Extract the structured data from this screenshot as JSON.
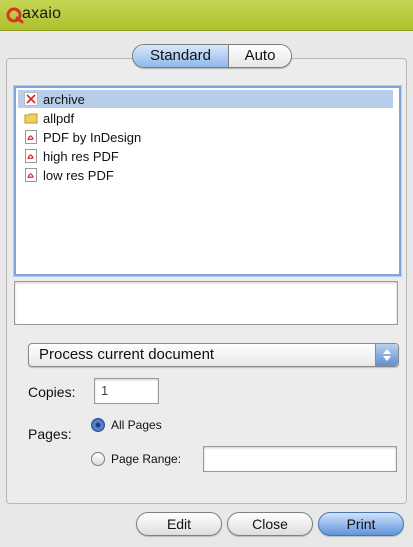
{
  "app": {
    "logo_text": "axaio",
    "logo_color": "#d8342a"
  },
  "tabs": [
    {
      "label": "Standard",
      "selected": true
    },
    {
      "label": "Auto",
      "selected": false
    }
  ],
  "file_list": [
    {
      "label": "archive",
      "icon": "remove-x-icon",
      "selected": true
    },
    {
      "label": "allpdf",
      "icon": "folder-icon",
      "selected": false
    },
    {
      "label": "PDF by InDesign",
      "icon": "pdf-file-icon",
      "selected": false
    },
    {
      "label": "high res PDF",
      "icon": "pdf-file-icon",
      "selected": false
    },
    {
      "label": "low res PDF",
      "icon": "pdf-file-icon",
      "selected": false
    }
  ],
  "process_select": {
    "value": "Process current document"
  },
  "copies": {
    "label": "Copies:",
    "value": "1"
  },
  "pages": {
    "label": "Pages:",
    "options": [
      {
        "label": "All Pages",
        "selected": true
      },
      {
        "label": "Page Range:",
        "selected": false
      }
    ],
    "range_value": ""
  },
  "buttons": {
    "edit": "Edit",
    "close": "Close",
    "print": "Print"
  }
}
